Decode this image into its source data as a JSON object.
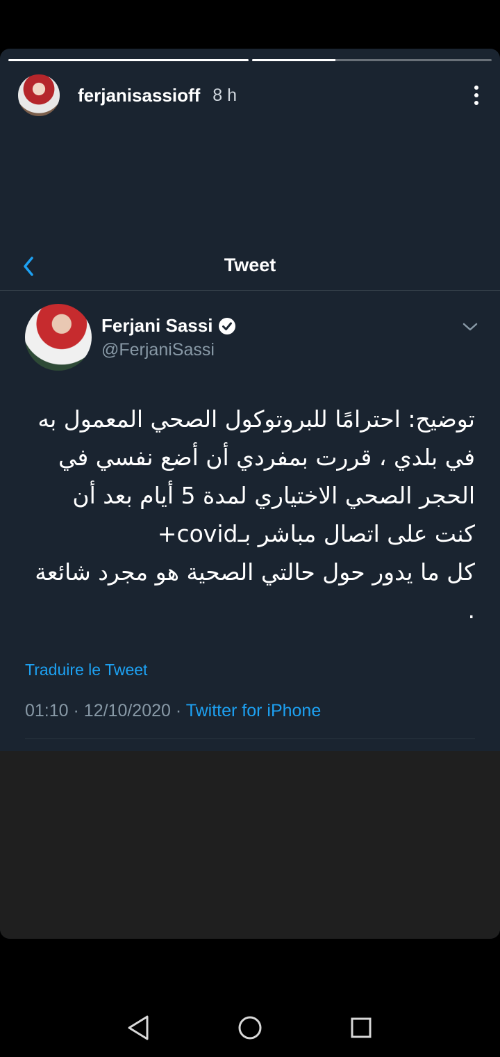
{
  "story": {
    "progress": [
      1.0,
      0.35
    ],
    "username": "ferjanisassioff",
    "time": "8 h"
  },
  "tweet_screen": {
    "title": "Tweet",
    "author": {
      "name": "Ferjani Sassi",
      "handle": "@FerjaniSassi"
    },
    "text": "توضيح: احترامًا للبروتوكول الصحي المعمول به في بلدي ، قررت بمفردي أن أضع نفسي في الحجر الصحي الاختياري لمدة 5 أيام بعد أن كنت على اتصال مباشر بـcovid+\nكل ما يدور حول حالتي الصحية هو مجرد شائعة .",
    "translate_label": "Traduire le Tweet",
    "time": "01:10",
    "date": "12/10/2020",
    "separator": "·",
    "source": "Twitter for iPhone"
  },
  "colors": {
    "background": "#1a2430",
    "accent": "#1da1f2",
    "muted": "#8899a6"
  }
}
